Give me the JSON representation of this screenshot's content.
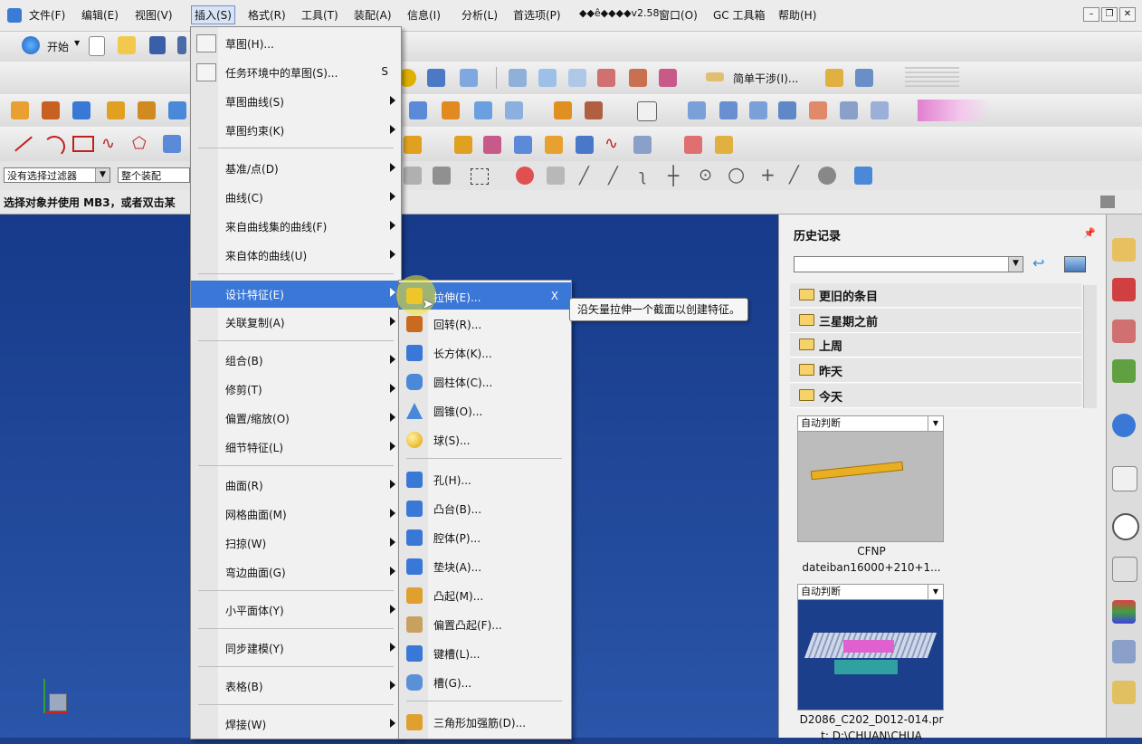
{
  "menubar": {
    "items": [
      "文件(F)",
      "编辑(E)",
      "视图(V)",
      "插入(S)",
      "格式(R)",
      "工具(T)",
      "装配(A)",
      "信息(I)",
      "分析(L)",
      "首选项(P)",
      "◆◆ê◆◆◆◆v2.58",
      "窗口(O)",
      "GC 工具箱",
      "帮助(H)"
    ],
    "window_controls": [
      "–",
      "❐",
      "✕"
    ]
  },
  "toolbar": {
    "start_label": "开始",
    "simple_interference": "简单干涉(I)..."
  },
  "filter": {
    "selection_filter": "没有选择过滤器",
    "scope": "整个装配"
  },
  "status": {
    "prompt": "选择对象并使用 MB3，或者双击某"
  },
  "insert_menu": [
    {
      "label": "草图(H)...",
      "submenu": false,
      "shortcut": ""
    },
    {
      "label": "任务环境中的草图(S)...",
      "submenu": false,
      "shortcut": "S"
    },
    {
      "label": "草图曲线(S)",
      "submenu": true
    },
    {
      "label": "草图约束(K)",
      "submenu": true
    },
    {
      "label": "基准/点(D)",
      "submenu": true
    },
    {
      "label": "曲线(C)",
      "submenu": true
    },
    {
      "label": "来自曲线集的曲线(F)",
      "submenu": true
    },
    {
      "label": "来自体的曲线(U)",
      "submenu": true
    },
    {
      "label": "设计特征(E)",
      "submenu": true,
      "highlight": true
    },
    {
      "label": "关联复制(A)",
      "submenu": true
    },
    {
      "label": "组合(B)",
      "submenu": true
    },
    {
      "label": "修剪(T)",
      "submenu": true
    },
    {
      "label": "偏置/缩放(O)",
      "submenu": true
    },
    {
      "label": "细节特征(L)",
      "submenu": true
    },
    {
      "label": "曲面(R)",
      "submenu": true
    },
    {
      "label": "网格曲面(M)",
      "submenu": true
    },
    {
      "label": "扫掠(W)",
      "submenu": true
    },
    {
      "label": "弯边曲面(G)",
      "submenu": true
    },
    {
      "label": "小平面体(Y)",
      "submenu": true
    },
    {
      "label": "同步建模(Y)",
      "submenu": true
    },
    {
      "label": "表格(B)",
      "submenu": true
    },
    {
      "label": "焊接(W)",
      "submenu": true
    }
  ],
  "design_feature_menu": [
    {
      "label": "拉伸(E)...",
      "icon": "extrude-icon",
      "shortcut": "X"
    },
    {
      "label": "回转(R)...",
      "icon": "revolve-icon"
    },
    {
      "label": "长方体(K)...",
      "icon": "block-icon"
    },
    {
      "label": "圆柱体(C)...",
      "icon": "cylinder-icon"
    },
    {
      "label": "圆锥(O)...",
      "icon": "cone-icon"
    },
    {
      "label": "球(S)...",
      "icon": "sphere-icon"
    },
    {
      "label": "孔(H)...",
      "icon": "hole-icon"
    },
    {
      "label": "凸台(B)...",
      "icon": "boss-icon"
    },
    {
      "label": "腔体(P)...",
      "icon": "pocket-icon"
    },
    {
      "label": "垫块(A)...",
      "icon": "pad-icon"
    },
    {
      "label": "凸起(M)...",
      "icon": "emboss-icon"
    },
    {
      "label": "偏置凸起(F)...",
      "icon": "offset-emboss-icon"
    },
    {
      "label": "键槽(L)...",
      "icon": "slot-icon"
    },
    {
      "label": "槽(G)...",
      "icon": "groove-icon"
    },
    {
      "label": "三角形加强筋(D)...",
      "icon": "dart-icon"
    }
  ],
  "tooltip": "沿矢量拉伸一个截面以创建特征。",
  "history": {
    "title": "历史记录",
    "groups": [
      "更旧的条目",
      "三星期之前",
      "上周",
      "昨天",
      "今天"
    ],
    "items": [
      {
        "mode": "自动判断",
        "line1": "CFNP",
        "line2": "dateiban16000+210+1..."
      },
      {
        "mode": "自动判断",
        "line1": "D2086_C202_D012-014.pr",
        "line2": "t: D:\\CHUAN\\CHUA"
      }
    ]
  },
  "colors": {
    "menu_highlight": "#3b77d6",
    "viewport": "#1e4494"
  }
}
